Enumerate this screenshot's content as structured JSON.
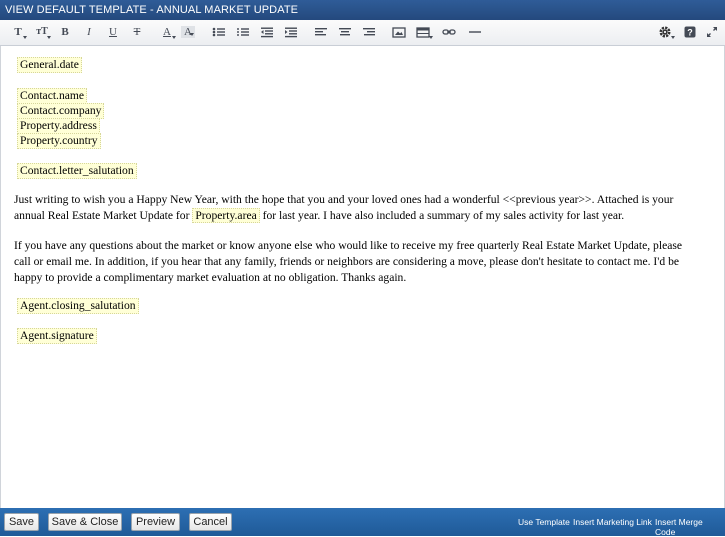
{
  "window": {
    "title": "VIEW DEFAULT TEMPLATE - ANNUAL MARKET UPDATE"
  },
  "toolbar": {
    "font_size_icon": "T",
    "text_size_icon": "тT",
    "bold_icon": "B",
    "italic_icon": "I",
    "underline_icon": "U",
    "strike_icon": "T",
    "font_color_icon": "A",
    "highlight_icon": "A"
  },
  "editor": {
    "fields": {
      "general_date": "General.date",
      "contact_name": "Contact.name",
      "contact_company": "Contact.company",
      "property_address": "Property.address",
      "property_country": "Property.country",
      "contact_letter_salutation": "Contact.letter_salutation",
      "agent_closing_salutation": "Agent.closing_salutation",
      "agent_signature": "Agent.signature"
    },
    "paragraph1": {
      "line1": "Just writing to wish you a Happy New Year, with the hope that you and your loved ones had a wonderful <<previous year>>. Attached is your",
      "line2_before": "annual Real Estate Market Update for ",
      "line2_field": "Property.area",
      "line2_after": " for last year. I have also included a summary of my sales activity for last year."
    },
    "paragraph2": {
      "line1": "If you have any questions about the market or know anyone else who would like to receive my free quarterly Real Estate Market Update, please",
      "line2": "call or email me. In addition, if you hear that any family, friends or neighbors are considering a move, please don't hesitate to contact me. I'd be",
      "line3": "happy to provide a complimentary market evaluation at no obligation. Thanks again."
    }
  },
  "footer": {
    "save_label": "Save",
    "save_close_label": "Save & Close",
    "preview_label": "Preview",
    "cancel_label": "Cancel",
    "use_template_link": "Use Template",
    "insert_marketing_link": "Insert Marketing Link",
    "insert_merge_code_link": "Insert Merge Code"
  },
  "colors": {
    "title_bar": "#24497d",
    "footer_bar": "#1f5a98",
    "merge_field_bg": "#ffffd6"
  }
}
